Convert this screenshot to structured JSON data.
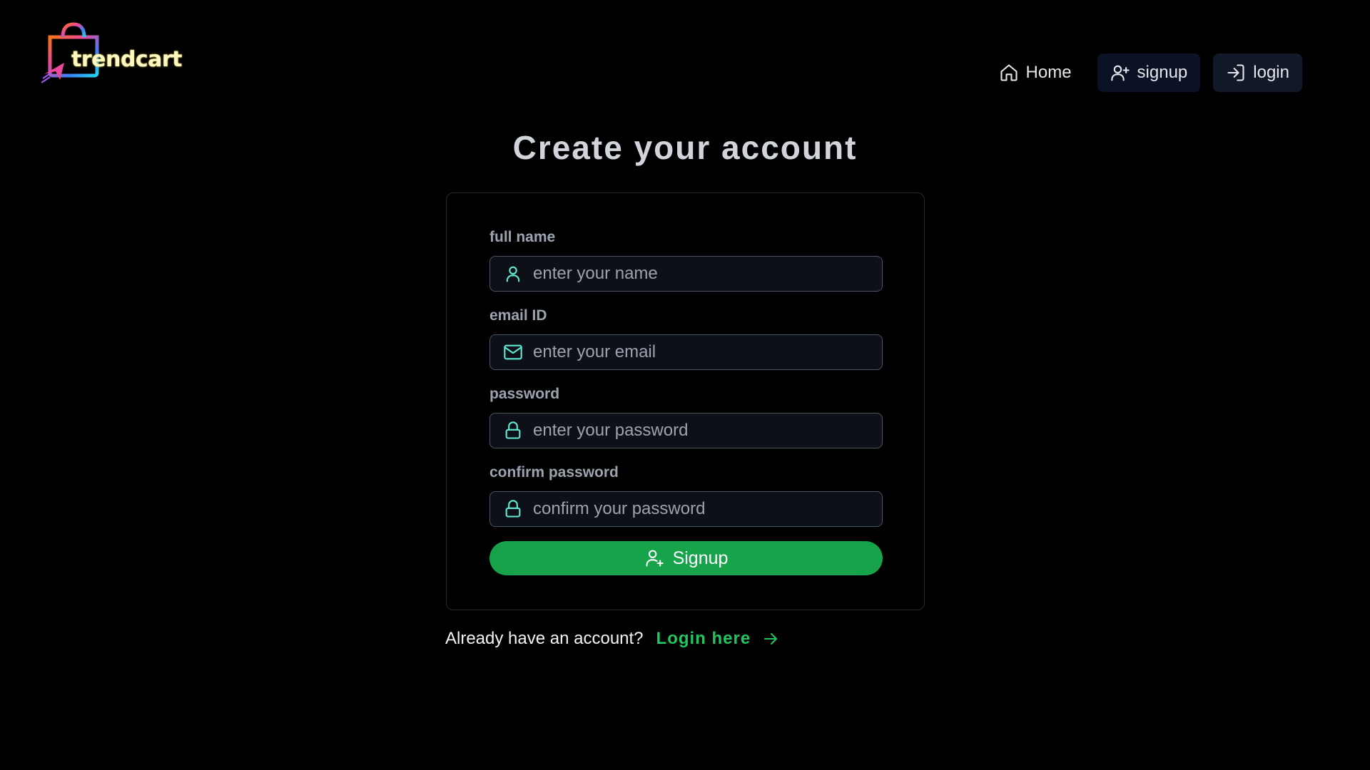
{
  "brand": {
    "name": "trendcart"
  },
  "nav": {
    "items": [
      {
        "label": "Home",
        "icon": "home-icon"
      },
      {
        "label": "signup",
        "icon": "user-plus-icon"
      },
      {
        "label": "login",
        "icon": "log-in-icon"
      }
    ]
  },
  "page": {
    "title": "Create your account"
  },
  "form": {
    "fields": [
      {
        "label": "full name",
        "placeholder": "enter your name",
        "value": "",
        "icon": "user-icon"
      },
      {
        "label": "email ID",
        "placeholder": "enter your email",
        "value": "",
        "icon": "mail-icon"
      },
      {
        "label": "password",
        "placeholder": "enter your password",
        "value": "",
        "icon": "lock-icon"
      },
      {
        "label": "confirm password",
        "placeholder": "confirm your password",
        "value": "",
        "icon": "lock-icon"
      }
    ],
    "submit_label": "Signup"
  },
  "footer": {
    "prompt": "Already have an account?",
    "link_label": "Login here"
  },
  "colors": {
    "background": "#000000",
    "accent_green": "#16a34a",
    "link_green": "#22c55e",
    "icon_teal": "#5eead4"
  }
}
